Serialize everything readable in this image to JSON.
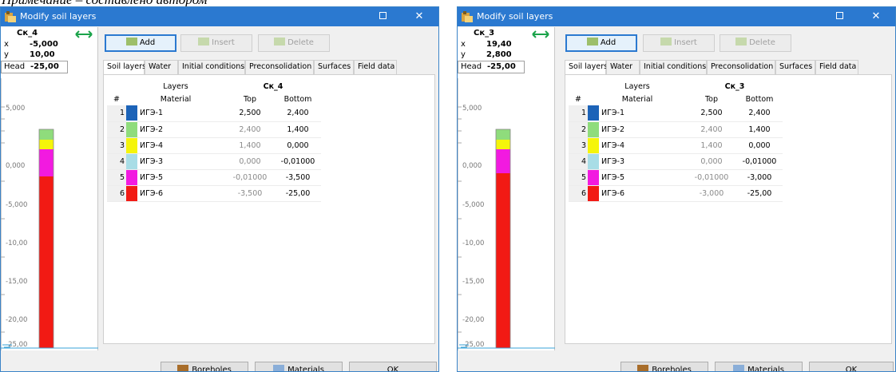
{
  "caption": "Примечание – составлено автором",
  "windows": [
    {
      "title": "Modify soil layers",
      "borehole": "Cк_4",
      "x_label": "x",
      "x_value": "-5,000",
      "y_label": "y",
      "y_value": "10,00",
      "head_label": "Head",
      "head_value": "-25,00",
      "scale_labels": [
        "5,000",
        "0,000",
        "-5,000",
        "-10,00",
        "-15,00",
        "-20,00",
        "-25,00"
      ],
      "toolbar": {
        "add": "Add",
        "insert": "Insert",
        "delete": "Delete"
      },
      "tabs": [
        "Soil layers",
        "Water",
        "Initial conditions",
        "Preconsolidation",
        "Surfaces",
        "Field data"
      ],
      "table": {
        "group_header": "Layers",
        "borehole_header": "Cк_4",
        "col_num": "#",
        "col_material": "Material",
        "col_top": "Top",
        "col_bottom": "Bottom",
        "rows": [
          {
            "num": "1",
            "material": "ИГЭ-1",
            "top": "2,500",
            "bottom": "2,400",
            "color": "#1c63b8"
          },
          {
            "num": "2",
            "material": "ИГЭ-2",
            "top": "2,400",
            "bottom": "1,400",
            "color": "#8fdc7c"
          },
          {
            "num": "3",
            "material": "ИГЭ-4",
            "top": "1,400",
            "bottom": "0,000",
            "color": "#f5f50a"
          },
          {
            "num": "4",
            "material": "ИГЭ-3",
            "top": "0,000",
            "bottom": "-0,01000",
            "color": "#a8dde6"
          },
          {
            "num": "5",
            "material": "ИГЭ-5",
            "top": "-0,01000",
            "bottom": "-3,500",
            "color": "#f21ae0"
          },
          {
            "num": "6",
            "material": "ИГЭ-6",
            "top": "-3,500",
            "bottom": "-25,00",
            "color": "#f21a14"
          }
        ]
      },
      "bottom_buttons": {
        "boreholes": "Boreholes",
        "materials": "Materials",
        "ok": "OK"
      }
    },
    {
      "title": "Modify soil layers",
      "borehole": "Cк_3",
      "x_label": "x",
      "x_value": "19,40",
      "y_label": "y",
      "y_value": "2,800",
      "head_label": "Head",
      "head_value": "-25,00",
      "scale_labels": [
        "5,000",
        "0,000",
        "-5,000",
        "-10,00",
        "-15,00",
        "-20,00",
        "-25,00"
      ],
      "toolbar": {
        "add": "Add",
        "insert": "Insert",
        "delete": "Delete"
      },
      "tabs": [
        "Soil layers",
        "Water",
        "Initial conditions",
        "Preconsolidation",
        "Surfaces",
        "Field data"
      ],
      "table": {
        "group_header": "Layers",
        "borehole_header": "Cк_3",
        "col_num": "#",
        "col_material": "Material",
        "col_top": "Top",
        "col_bottom": "Bottom",
        "rows": [
          {
            "num": "1",
            "material": "ИГЭ-1",
            "top": "2,500",
            "bottom": "2,400",
            "color": "#1c63b8"
          },
          {
            "num": "2",
            "material": "ИГЭ-2",
            "top": "2,400",
            "bottom": "1,400",
            "color": "#8fdc7c"
          },
          {
            "num": "3",
            "material": "ИГЭ-4",
            "top": "1,400",
            "bottom": "0,000",
            "color": "#f5f50a"
          },
          {
            "num": "4",
            "material": "ИГЭ-3",
            "top": "0,000",
            "bottom": "-0,01000",
            "color": "#a8dde6"
          },
          {
            "num": "5",
            "material": "ИГЭ-5",
            "top": "-0,01000",
            "bottom": "-3,000",
            "color": "#f21ae0"
          },
          {
            "num": "6",
            "material": "ИГЭ-6",
            "top": "-3,000",
            "bottom": "-25,00",
            "color": "#f21a14"
          }
        ]
      },
      "bottom_buttons": {
        "boreholes": "Boreholes",
        "materials": "Materials",
        "ok": "OK"
      }
    }
  ]
}
